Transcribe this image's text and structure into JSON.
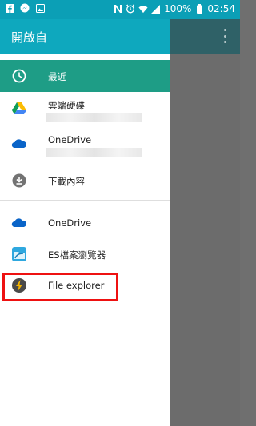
{
  "status_bar": {
    "icons_left": [
      "facebook-icon",
      "messenger-icon",
      "image-icon"
    ],
    "icons_right": [
      "nfc-icon",
      "alarm-icon",
      "wifi-icon",
      "signal-icon"
    ],
    "battery": "100%",
    "time": "02:54"
  },
  "drawer": {
    "title": "開啟自",
    "items": [
      {
        "label": "最近",
        "icon": "clock-icon",
        "active": true
      },
      {
        "label": "雲端硬碟",
        "icon": "google-drive-icon"
      },
      {
        "label": "OneDrive",
        "icon": "onedrive-icon"
      },
      {
        "label": "下載內容",
        "icon": "download-icon"
      },
      {
        "label": "OneDrive",
        "icon": "onedrive-icon"
      },
      {
        "label": "ES檔案瀏覽器",
        "icon": "es-file-explorer-icon"
      },
      {
        "label": "File explorer",
        "icon": "file-explorer-icon"
      }
    ]
  },
  "colors": {
    "status_bar": "#0b9fb6",
    "header": "#0ea8be",
    "active_item": "#1e9d86",
    "highlight": "#ee1111"
  }
}
